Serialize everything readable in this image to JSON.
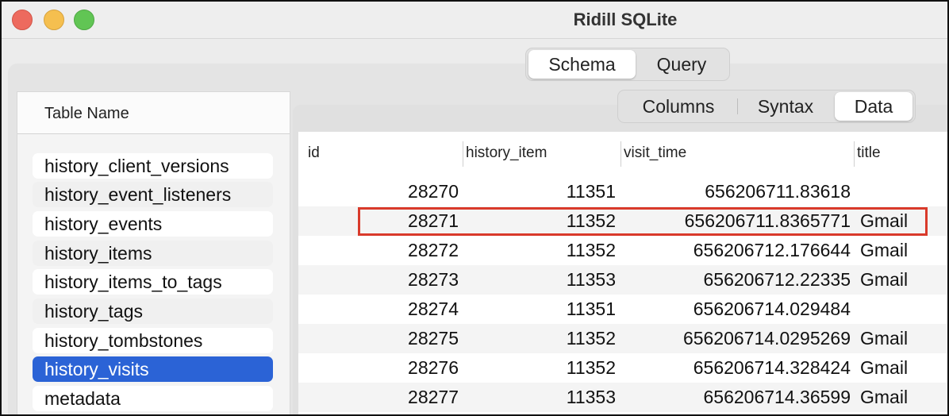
{
  "window": {
    "title": "Ridill SQLite"
  },
  "top_tabs": [
    {
      "label": "Schema",
      "active": true
    },
    {
      "label": "Query",
      "active": false
    }
  ],
  "sub_tabs": [
    {
      "label": "Columns",
      "active": false
    },
    {
      "label": "Syntax",
      "active": false
    },
    {
      "label": "Data",
      "active": true
    }
  ],
  "sidebar": {
    "header": "Table Name",
    "tables": [
      {
        "name": "history_client_versions"
      },
      {
        "name": "history_event_listeners"
      },
      {
        "name": "history_events"
      },
      {
        "name": "history_items"
      },
      {
        "name": "history_items_to_tags"
      },
      {
        "name": "history_tags"
      },
      {
        "name": "history_tombstones"
      },
      {
        "name": "history_visits",
        "selected": true
      },
      {
        "name": "metadata"
      }
    ]
  },
  "data_grid": {
    "columns": [
      "id",
      "history_item",
      "visit_time",
      "title"
    ],
    "rows": [
      {
        "id": "28270",
        "history_item": "11351",
        "visit_time": "656206711.83618",
        "title": ""
      },
      {
        "id": "28271",
        "history_item": "11352",
        "visit_time": "656206711.8365771",
        "title": "Gmail",
        "highlighted": true
      },
      {
        "id": "28272",
        "history_item": "11352",
        "visit_time": "656206712.176644",
        "title": "Gmail"
      },
      {
        "id": "28273",
        "history_item": "11353",
        "visit_time": "656206712.22335",
        "title": "Gmail"
      },
      {
        "id": "28274",
        "history_item": "11351",
        "visit_time": "656206714.029484",
        "title": ""
      },
      {
        "id": "28275",
        "history_item": "11352",
        "visit_time": "656206714.0295269",
        "title": "Gmail"
      },
      {
        "id": "28276",
        "history_item": "11352",
        "visit_time": "656206714.328424",
        "title": "Gmail"
      },
      {
        "id": "28277",
        "history_item": "11353",
        "visit_time": "656206714.36599",
        "title": "Gmail"
      }
    ]
  },
  "colors": {
    "selection": "#2b63d6",
    "highlight_border": "#d93a2b"
  }
}
